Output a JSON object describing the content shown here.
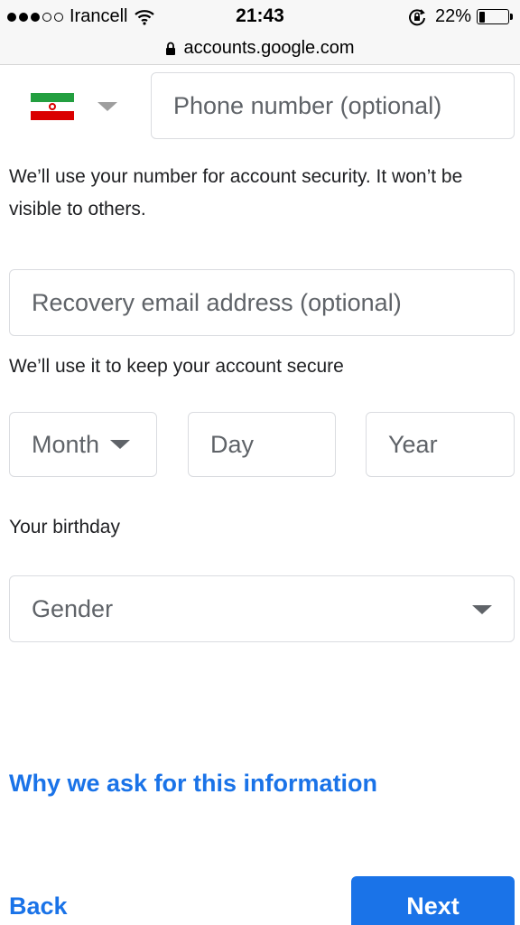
{
  "status_bar": {
    "carrier": "Irancell",
    "time": "21:43",
    "battery": "22%",
    "battery_level": 0.22
  },
  "url_bar": {
    "url": "accounts.google.com"
  },
  "form": {
    "phone": {
      "placeholder": "Phone number (optional)"
    },
    "phone_helper": "We’ll use your number for account security. It won’t be visible to others.",
    "recovery": {
      "placeholder": "Recovery email address (optional)"
    },
    "recovery_helper": "We’ll use it to keep your account secure",
    "birthday": {
      "month": "Month",
      "day": "Day",
      "year": "Year",
      "helper": "Your birthday"
    },
    "gender": "Gender"
  },
  "links": {
    "why": "Why we ask for this information",
    "back": "Back"
  },
  "buttons": {
    "next": "Next"
  },
  "colors": {
    "accent": "#1a73e8",
    "border": "#dadce0",
    "placeholder": "#5f6368"
  },
  "icons": {
    "flag": "iran-flag-icon",
    "dropdown": "chevron-down-icon",
    "wifi": "wifi-icon",
    "lock": "lock-icon"
  }
}
